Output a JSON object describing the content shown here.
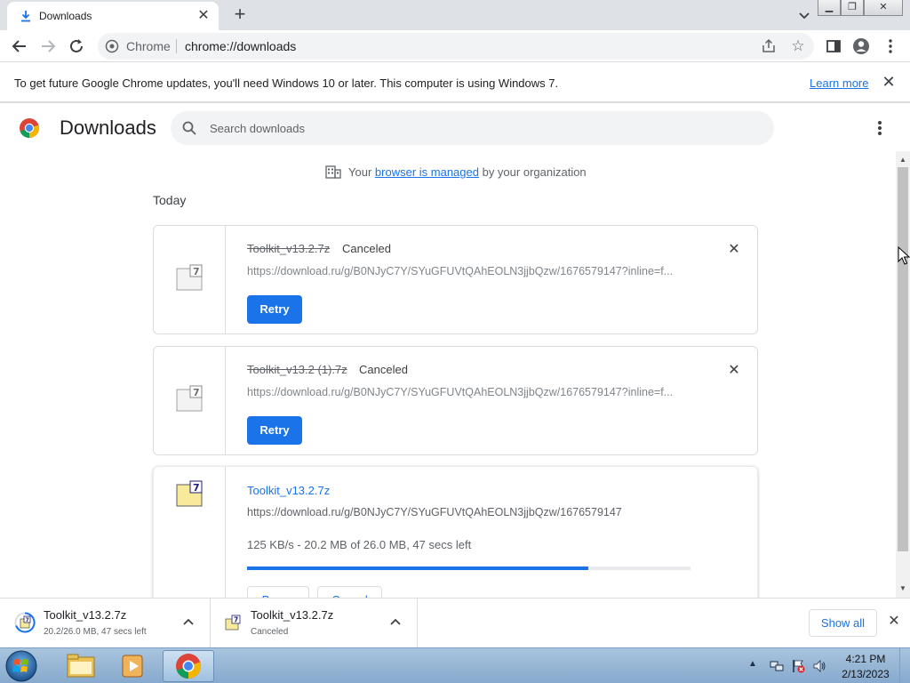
{
  "tab": {
    "title": "Downloads",
    "close_glyph": "✕"
  },
  "toolbar": {
    "chip": "Chrome",
    "url": "chrome://downloads"
  },
  "infobar": {
    "message": "To get future Google Chrome updates, you'll need Windows 10 or later. This computer is using Windows 7.",
    "link": "Learn more",
    "close_glyph": "✕"
  },
  "header": {
    "title": "Downloads",
    "search_placeholder": "Search downloads"
  },
  "managed": {
    "prefix": "Your",
    "link": "browser is managed",
    "suffix": "by your organization"
  },
  "date_header": "Today",
  "downloads": [
    {
      "name": "Toolkit_v13.2.7z",
      "status": "Canceled",
      "url": "https://download.ru/g/B0NJyC7Y/SYuGFUVtQAhEOLN3jjbQzw/1676579147?inline=f...",
      "button": "Retry"
    },
    {
      "name": "Toolkit_v13.2 (1).7z",
      "status": "Canceled",
      "url": "https://download.ru/g/B0NJyC7Y/SYuGFUVtQAhEOLN3jjbQzw/1676579147?inline=f...",
      "button": "Retry"
    },
    {
      "name": "Toolkit_v13.2.7z",
      "url": "https://download.ru/g/B0NJyC7Y/SYuGFUVtQAhEOLN3jjbQzw/1676579147",
      "progress_text": "125 KB/s - 20.2 MB of 26.0 MB, 47 secs left",
      "progress_fraction": 0.77,
      "buttons": [
        "Pause",
        "Cancel"
      ]
    }
  ],
  "shelf": {
    "items": [
      {
        "name": "Toolkit_v13.2.7z",
        "sub": "20.2/26.0 MB, 47 secs left"
      },
      {
        "name": "Toolkit_v13.2.7z",
        "sub": "Canceled"
      }
    ],
    "show_all": "Show all"
  },
  "taskbar": {
    "time": "4:21 PM",
    "date": "2/13/2023"
  },
  "colors": {
    "accent": "#1a73e8",
    "tabstrip": "#dee1e6",
    "taskbar": "#86a9cd"
  }
}
